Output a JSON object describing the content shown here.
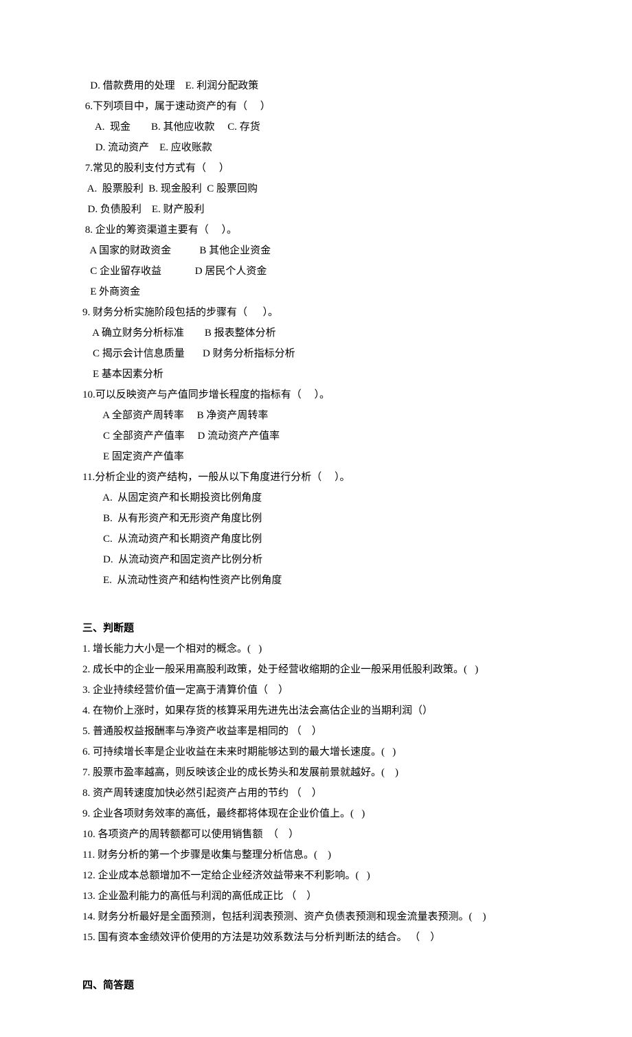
{
  "q5_options_de": "   D. 借款费用的处理    E. 利润分配政策",
  "q6": {
    "stem": " 6.下列项目中，属于速动资产的有（     ）",
    "a": "     A.  现金        B. 其他应收款     C. 存货",
    "b": "     D. 流动资产    E. 应收账款"
  },
  "q7": {
    "stem": " 7.常见的股利支付方式有（     ）",
    "a": "  A.  股票股利  B. 现金股利  C 股票回购",
    "b": "  D. 负债股利    E. 财产股利"
  },
  "q8": {
    "stem": " 8. 企业的筹资渠道主要有（     ）。",
    "a": "   A 国家的财政资金           B 其他企业资金",
    "b": "   C 企业留存收益             D 居民个人资金",
    "c": "   E 外商资金"
  },
  "q9": {
    "stem": "9. 财务分析实施阶段包括的步骤有（      ）。",
    "a": "    A 确立财务分析标准        B 报表整体分析",
    "b": "    C 揭示会计信息质量       D 财务分析指标分析",
    "c": "    E 基本因素分析"
  },
  "q10": {
    "stem": "10.可以反映资产与产值同步增长程度的指标有（     ）。",
    "a": "        A 全部资产周转率     B 净资产周转率",
    "b": "        C 全部资产产值率     D 流动资产产值率",
    "c": "        E 固定资产产值率"
  },
  "q11": {
    "stem": "11.分析企业的资产结构，一般从以下角度进行分析（     ）。",
    "a": "        A.  从固定资产和长期投资比例角度",
    "b": "        B.  从有形资产和无形资产角度比例",
    "c": "        C.  从流动资产和长期资产角度比例",
    "d": "        D.  从流动资产和固定资产比例分析",
    "e": "        E.  从流动性资产和结构性资产比例角度"
  },
  "section3_title": "三、判断题",
  "tf": {
    "1": "1. 增长能力大小是一个相对的概念。(   )",
    "2": "2. 成长中的企业一般采用高股利政策，处于经营收缩期的企业一般采用低股利政策。(   )",
    "3": "3. 企业持续经营价值一定高于清算价值（    ）",
    "4": "4. 在物价上涨时，如果存货的核算采用先进先出法会高估企业的当期利润（）",
    "5": "5. 普通股权益报酬率与净资产收益率是相同的 （    ）",
    "6": "6. 可持续增长率是企业收益在未来时期能够达到的最大增长速度。(   )",
    "7": "7. 股票市盈率越高，则反映该企业的成长势头和发展前景就越好。(    )",
    "8": "8. 资产周转速度加快必然引起资产占用的节约 （    ）",
    "9": "9. 企业各项财务效率的高低，最终都将体现在企业价值上。(   )",
    "10": "10. 各项资产的周转额都可以使用销售额  （    ）",
    "11": "11. 财务分析的第一个步骤是收集与整理分析信息。(    )",
    "12": "12. 企业成本总额增加不一定给企业经济效益带来不利影响。(   )",
    "13": "13. 企业盈利能力的高低与利润的高低成正比 （    ）",
    "14": "14. 财务分析最好是全面预测，包括利润表预测、资产负债表预测和现金流量表预测。(    )",
    "15": "15. 国有资本金绩效评价使用的方法是功效系数法与分析判断法的结合。 （    ）"
  },
  "section4_title": "四、简答题"
}
